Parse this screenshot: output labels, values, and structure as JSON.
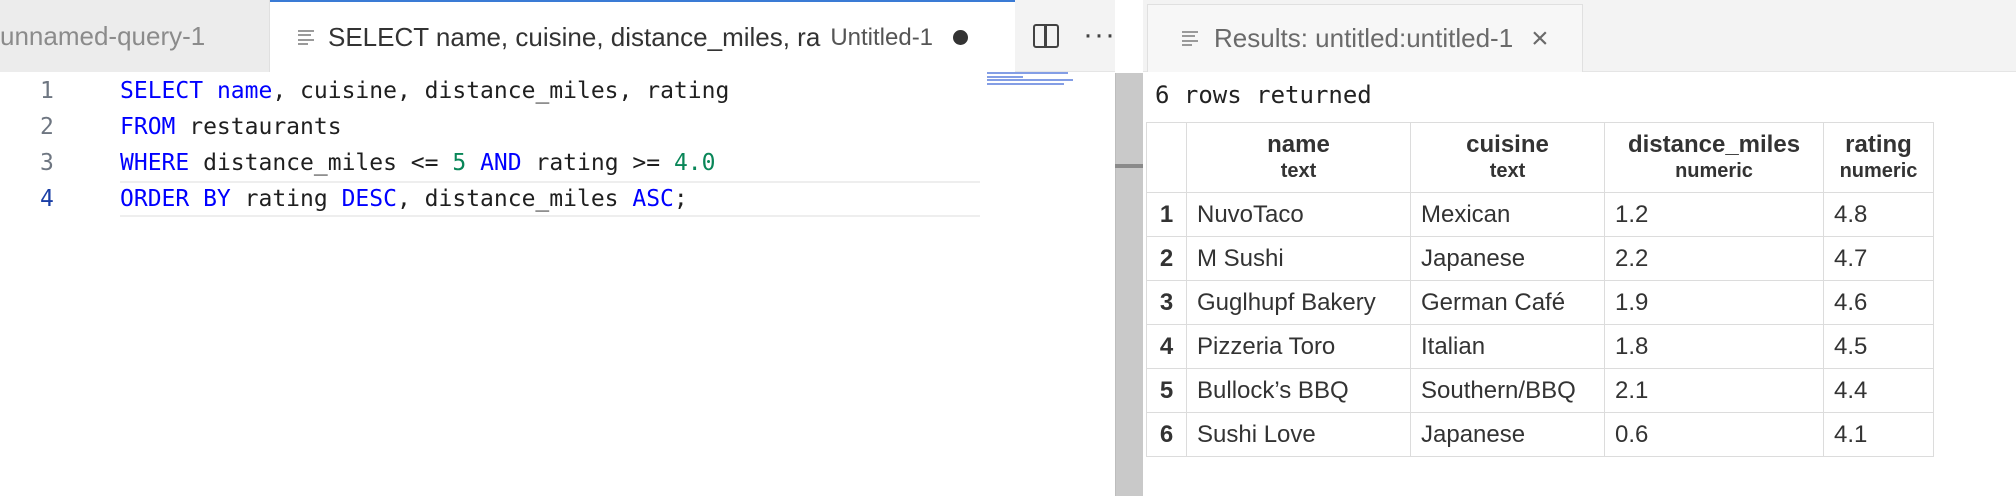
{
  "editor_tabs": [
    {
      "title": "unnamed-query-1",
      "active": false
    },
    {
      "title": "SELECT name, cuisine, distance_miles, ra",
      "description": "Untitled-1",
      "active": true,
      "dirty": true
    }
  ],
  "editor_actions": {
    "split_icon": "split-editor-icon",
    "more_icon": "more-actions-icon",
    "more_glyph": "···"
  },
  "results_tab": {
    "title": "Results: untitled:untitled-1",
    "close_glyph": "×"
  },
  "code_lines": [
    {
      "number": "1",
      "tokens": [
        {
          "text": "SELECT",
          "type": "kw"
        },
        {
          "text": " "
        },
        {
          "text": "name",
          "type": "kw"
        },
        {
          "text": ", cuisine, distance_miles, rating"
        }
      ]
    },
    {
      "number": "2",
      "tokens": [
        {
          "text": "FROM",
          "type": "kw"
        },
        {
          "text": " restaurants"
        }
      ]
    },
    {
      "number": "3",
      "tokens": [
        {
          "text": "WHERE",
          "type": "kw"
        },
        {
          "text": " distance_miles <= "
        },
        {
          "text": "5",
          "type": "num"
        },
        {
          "text": " "
        },
        {
          "text": "AND",
          "type": "kw"
        },
        {
          "text": " rating >= "
        },
        {
          "text": "4.0",
          "type": "num"
        }
      ]
    },
    {
      "number": "4",
      "current": true,
      "tokens": [
        {
          "text": "ORDER BY",
          "type": "kw"
        },
        {
          "text": " rating "
        },
        {
          "text": "DESC",
          "type": "kw"
        },
        {
          "text": ", distance_miles "
        },
        {
          "text": "ASC",
          "type": "kw"
        },
        {
          "text": ";"
        }
      ]
    }
  ],
  "results": {
    "rows_returned": "6 rows returned",
    "columns": [
      {
        "name": "name",
        "type": "text"
      },
      {
        "name": "cuisine",
        "type": "text"
      },
      {
        "name": "distance_miles",
        "type": "numeric"
      },
      {
        "name": "rating",
        "type": "numeric"
      }
    ],
    "rows": [
      {
        "num": "1",
        "cells": [
          "NuvoTaco",
          "Mexican",
          "1.2",
          "4.8"
        ]
      },
      {
        "num": "2",
        "cells": [
          "M Sushi",
          "Japanese",
          "2.2",
          "4.7"
        ]
      },
      {
        "num": "3",
        "cells": [
          "Guglhupf Bakery",
          "German Café",
          "1.9",
          "4.6"
        ]
      },
      {
        "num": "4",
        "cells": [
          "Pizzeria Toro",
          "Italian",
          "1.8",
          "4.5"
        ]
      },
      {
        "num": "5",
        "cells": [
          "Bullock’s BBQ",
          "Southern/BBQ",
          "2.1",
          "4.4"
        ]
      },
      {
        "num": "6",
        "cells": [
          "Sushi Love",
          "Japanese",
          "0.6",
          "4.1"
        ]
      }
    ]
  },
  "colors": {
    "keyword": "#0000ff",
    "number": "#098658",
    "tab_accent": "#3a7bd5"
  }
}
